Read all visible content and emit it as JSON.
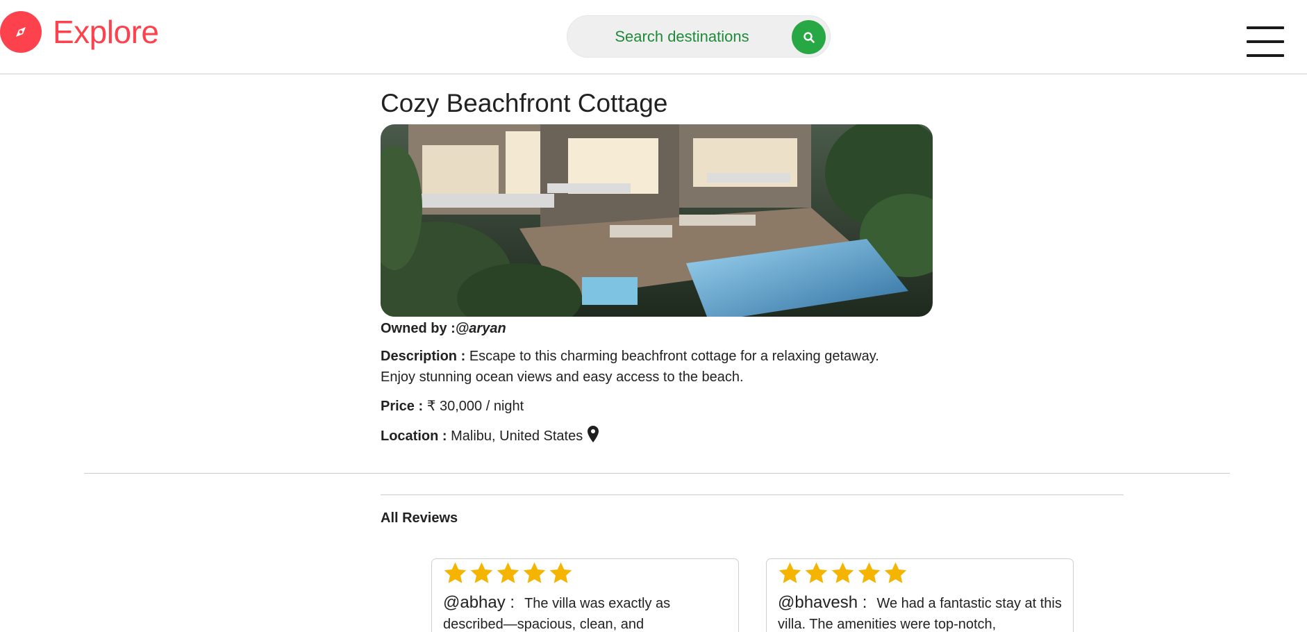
{
  "nav": {
    "brand": "Explore",
    "search_placeholder": "Search destinations"
  },
  "listing": {
    "title": "Cozy Beachfront Cottage",
    "owner_label": "Owned by :",
    "owner": "@aryan",
    "description_label": "Description :",
    "description": "Escape to this charming beachfront cottage for a relaxing getaway.",
    "description_line2": "Enjoy stunning ocean views and easy access to the beach.",
    "price_label": "Price :",
    "price": "₹ 30,000 / night",
    "location_label": "Location :",
    "location": "Malibu, United States"
  },
  "reviews": {
    "heading": "All Reviews",
    "items": [
      {
        "author": "@abhay :",
        "text": "The villa was exactly as described—spacious, clean, and",
        "rating": 5
      },
      {
        "author": "@bhavesh :",
        "text": "We had a fantastic stay at this villa. The amenities were top-notch,",
        "rating": 5
      }
    ]
  },
  "colors": {
    "brand": "#fe424d",
    "search_text": "#1e8a3a",
    "search_button": "#28a745",
    "star": "#f4b400"
  }
}
